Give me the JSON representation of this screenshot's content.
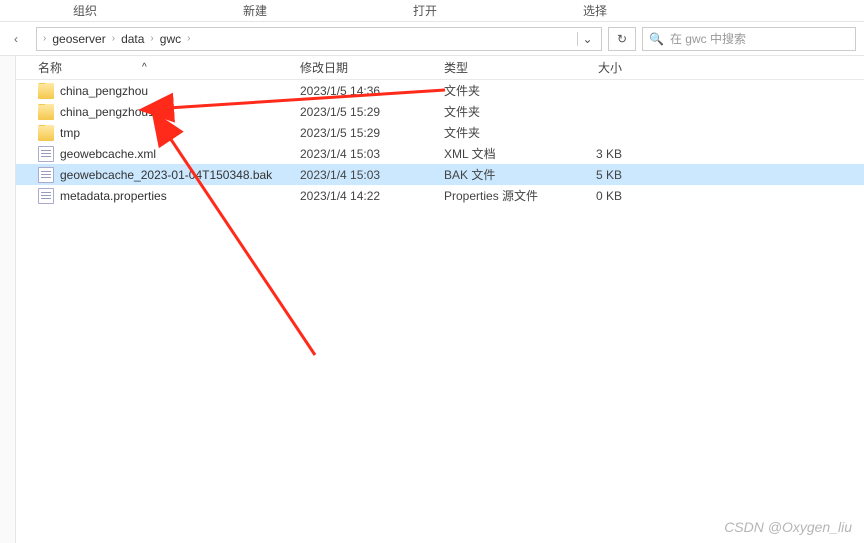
{
  "menu": {
    "organize": "组织",
    "new": "新建",
    "open": "打开",
    "select": "选择"
  },
  "breadcrumb": {
    "items": [
      "geoserver",
      "data",
      "gwc"
    ],
    "dropdown": "⌄"
  },
  "refresh_icon": "↻",
  "search": {
    "icon": "🔍",
    "placeholder": "在 gwc 中搜索"
  },
  "columns": {
    "name": "名称",
    "date": "修改日期",
    "type": "类型",
    "size": "大小",
    "sort": "^"
  },
  "rows": [
    {
      "icon": "folder",
      "name": "china_pengzhou",
      "date": "2023/1/5 14:36",
      "type": "文件夹",
      "size": ""
    },
    {
      "icon": "folder",
      "name": "china_pengzhou1",
      "date": "2023/1/5 15:29",
      "type": "文件夹",
      "size": ""
    },
    {
      "icon": "folder",
      "name": "tmp",
      "date": "2023/1/5 15:29",
      "type": "文件夹",
      "size": ""
    },
    {
      "icon": "file",
      "name": "geowebcache.xml",
      "date": "2023/1/4 15:03",
      "type": "XML 文档",
      "size": "3 KB"
    },
    {
      "icon": "file",
      "name": "geowebcache_2023-01-04T150348.bak",
      "date": "2023/1/4 15:03",
      "type": "BAK 文件",
      "size": "5 KB",
      "selected": true
    },
    {
      "icon": "file",
      "name": "metadata.properties",
      "date": "2023/1/4 14:22",
      "type": "Properties 源文件",
      "size": "0 KB"
    }
  ],
  "watermark": "CSDN @Oxygen_liu",
  "annotation": {
    "color": "#ff2a1a"
  }
}
